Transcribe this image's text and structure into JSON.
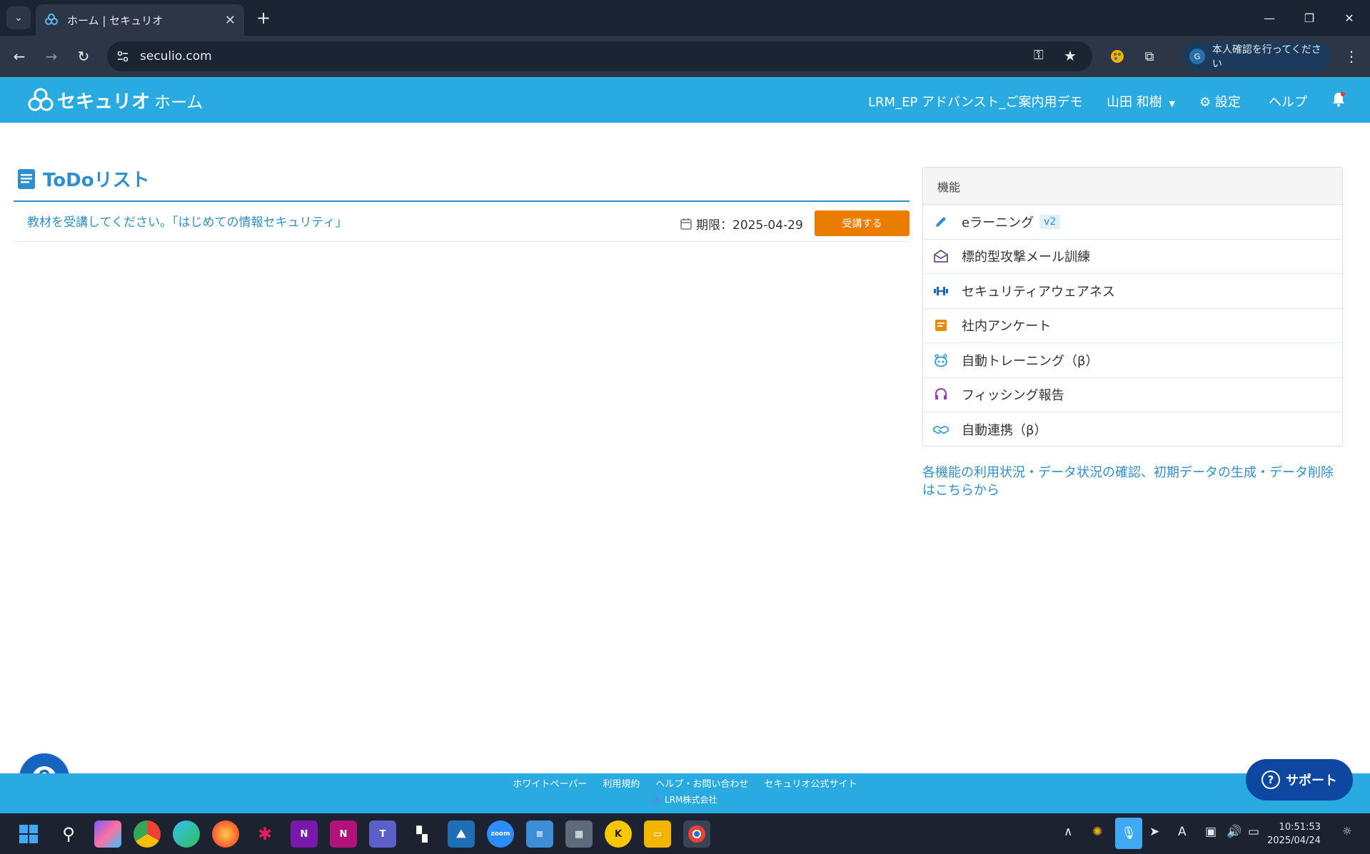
{
  "browser": {
    "tab_title": "ホーム | セキュリオ",
    "url": "seculio.com",
    "profile_label": "本人確認を行ってください",
    "profile_initial": "G"
  },
  "header": {
    "logo_text": "セキュリオ",
    "page_label": "ホーム",
    "org_name": "LRM_EP アドバンスト_ご案内用デモ",
    "user_name": "山田 和樹",
    "settings_label": "設定",
    "help_label": "ヘルプ"
  },
  "todo": {
    "title": "ToDoリスト",
    "items": [
      {
        "text": "教材を受講してください。「はじめての情報セキュリティ」",
        "deadline": "期限：2025-04-29",
        "action": "受講する"
      }
    ]
  },
  "features": {
    "title": "機能",
    "items": [
      {
        "label": "eラーニング",
        "badge": "v2",
        "icon": "pencil-icon"
      },
      {
        "label": "標的型攻撃メール訓練",
        "icon": "mail-icon"
      },
      {
        "label": "セキュリティアウェアネス",
        "icon": "dumbbell-icon"
      },
      {
        "label": "社内アンケート",
        "icon": "survey-icon"
      },
      {
        "label": "自動トレーニング（β）",
        "icon": "robot-icon"
      },
      {
        "label": "フィッシング報告",
        "icon": "headset-icon"
      },
      {
        "label": "自動連携（β）",
        "icon": "handshake-icon"
      }
    ],
    "note": "各機能の利用状況・データ状況の確認、初期データの生成・データ削除はこちらから"
  },
  "footer": {
    "links": [
      "ホワイトペーパー",
      "利用規約",
      "ヘルプ・お問い合わせ",
      "セキュリオ公式サイト"
    ],
    "copyright": "LRM株式会社"
  },
  "support": {
    "label": "サポート"
  },
  "taskbar": {
    "time": "10:51:53",
    "date": "2025/04/24",
    "zoom_label": "zoom",
    "ime_label": "A"
  },
  "colors": {
    "brand": "#29abe2",
    "link": "#2d8fcf",
    "action": "#ea7c00",
    "support": "#0d47a1"
  }
}
